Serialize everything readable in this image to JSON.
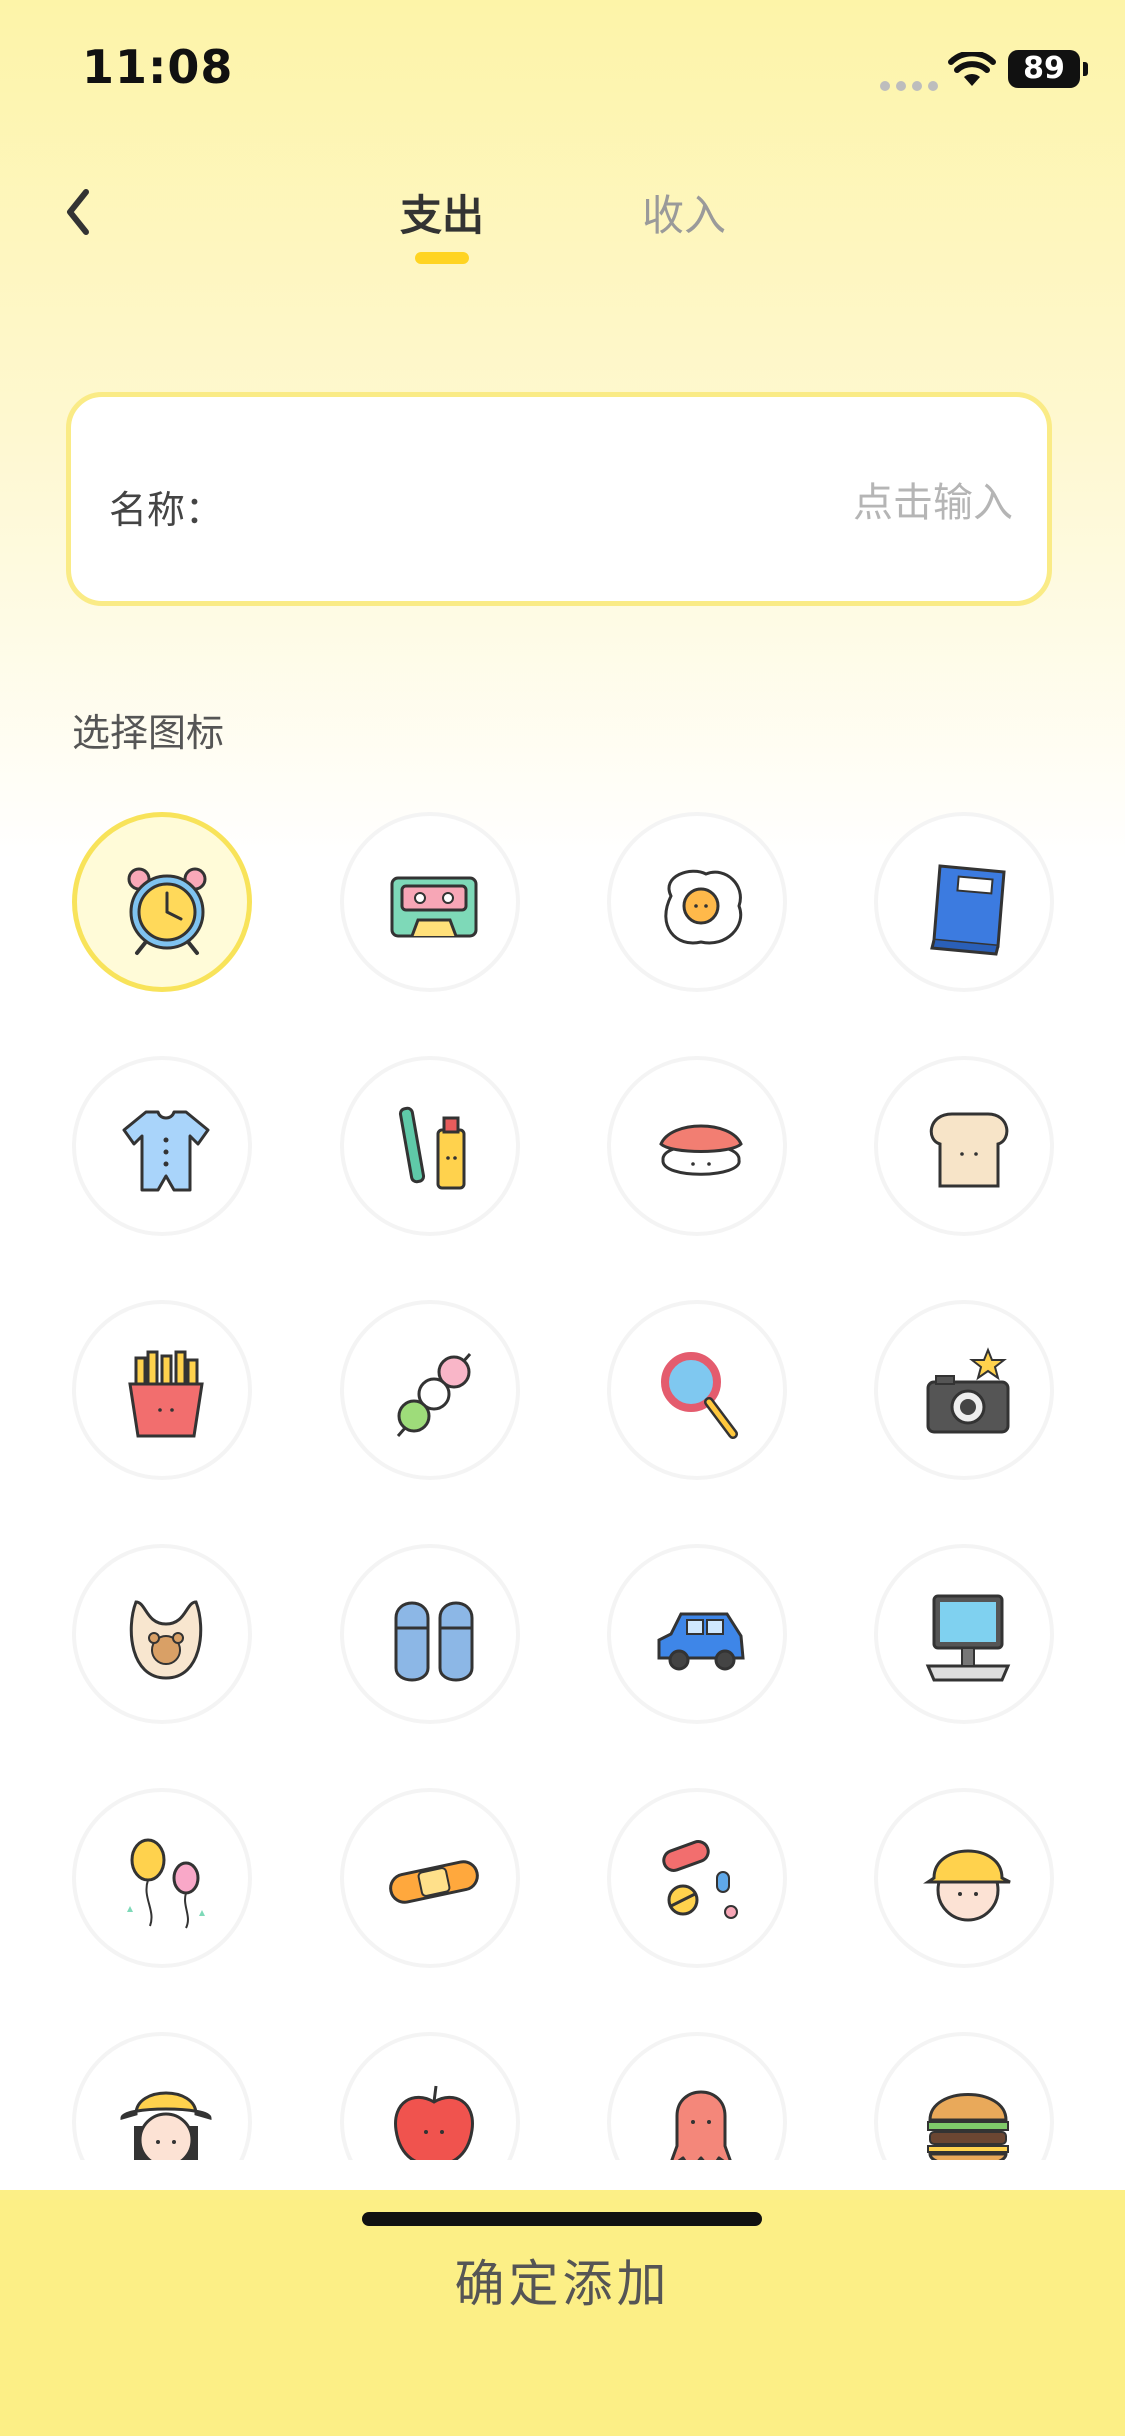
{
  "status_bar": {
    "time": "11:08",
    "battery": "89"
  },
  "nav": {
    "tabs": [
      {
        "label": "支出",
        "active": true
      },
      {
        "label": "收入",
        "active": false
      }
    ]
  },
  "form": {
    "name_label": "名称：",
    "name_placeholder": "点击输入",
    "name_value": ""
  },
  "section": {
    "choose_icon": "选择图标"
  },
  "icons": [
    "alarm-clock-icon",
    "cassette-tape-icon",
    "fried-egg-icon",
    "notebook-icon",
    "baby-romper-icon",
    "toothbrush-toothpaste-icon",
    "sushi-icon",
    "bread-toast-icon",
    "french-fries-icon",
    "dango-skewer-icon",
    "magnifier-icon",
    "camera-icon",
    "baby-bib-icon",
    "slippers-icon",
    "car-icon",
    "pc-computer-icon",
    "balloons-icon",
    "bandage-icon",
    "pills-icon",
    "kid-yellow-cap-icon",
    "girl-yellow-hat-icon",
    "apple-icon",
    "octopus-icon",
    "burger-icon"
  ],
  "selected_icon": "alarm-clock-icon",
  "footer": {
    "confirm_label": "确定添加"
  },
  "colors": {
    "accent": "#FFD423",
    "footer_bg": "#FCEF86",
    "selected_ring": "#F8E35A"
  }
}
